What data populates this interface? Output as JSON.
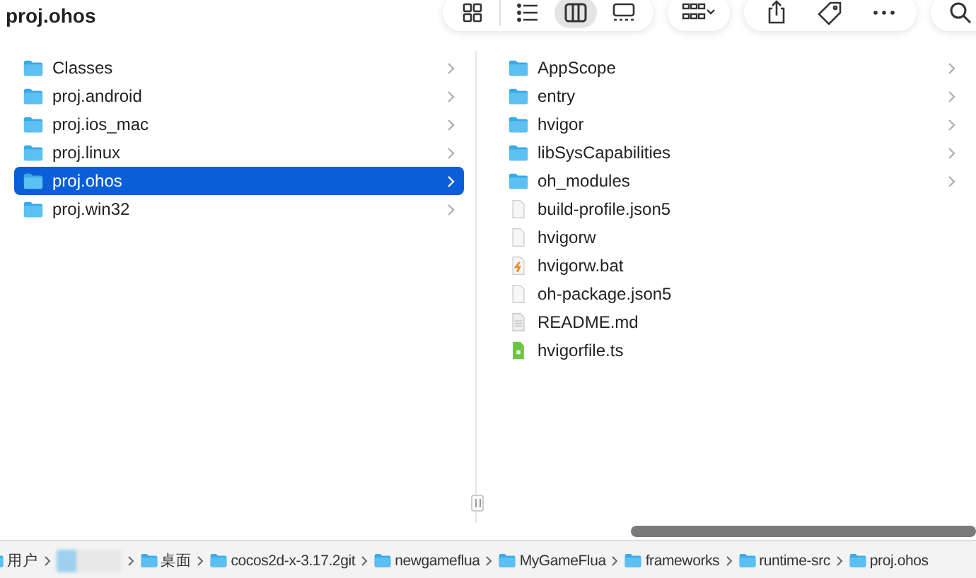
{
  "window": {
    "title": "proj.ohos"
  },
  "toolbar": {
    "view_modes": [
      {
        "kind": "icons",
        "selected": false
      },
      {
        "kind": "list",
        "selected": false
      },
      {
        "kind": "columns",
        "selected": true
      },
      {
        "kind": "gallery",
        "selected": false
      }
    ]
  },
  "columns": [
    {
      "items": [
        {
          "name": "Classes",
          "kind": "folder",
          "selected": false
        },
        {
          "name": "proj.android",
          "kind": "folder",
          "selected": false
        },
        {
          "name": "proj.ios_mac",
          "kind": "folder",
          "selected": false
        },
        {
          "name": "proj.linux",
          "kind": "folder",
          "selected": false
        },
        {
          "name": "proj.ohos",
          "kind": "folder",
          "selected": true
        },
        {
          "name": "proj.win32",
          "kind": "folder",
          "selected": false
        }
      ]
    },
    {
      "items": [
        {
          "name": "AppScope",
          "kind": "folder",
          "selected": false
        },
        {
          "name": "entry",
          "kind": "folder",
          "selected": false
        },
        {
          "name": "hvigor",
          "kind": "folder",
          "selected": false
        },
        {
          "name": "libSysCapabilities",
          "kind": "folder",
          "selected": false
        },
        {
          "name": "oh_modules",
          "kind": "folder",
          "selected": false
        },
        {
          "name": "build-profile.json5",
          "kind": "file",
          "selected": false
        },
        {
          "name": "hvigorw",
          "kind": "file",
          "selected": false
        },
        {
          "name": "hvigorw.bat",
          "kind": "script",
          "selected": false
        },
        {
          "name": "oh-package.json5",
          "kind": "file",
          "selected": false
        },
        {
          "name": "README.md",
          "kind": "text",
          "selected": false
        },
        {
          "name": "hvigorfile.ts",
          "kind": "code",
          "selected": false
        }
      ]
    }
  ],
  "path_bar": [
    {
      "label": "用户",
      "kind": "folder"
    },
    {
      "kind": "redacted"
    },
    {
      "label": "桌面",
      "kind": "folder"
    },
    {
      "label": "cocos2d-x-3.17.2git",
      "kind": "folder"
    },
    {
      "label": "newgameflua",
      "kind": "folder"
    },
    {
      "label": "MyGameFlua",
      "kind": "folder"
    },
    {
      "label": "frameworks",
      "kind": "folder"
    },
    {
      "label": "runtime-src",
      "kind": "folder"
    },
    {
      "label": "proj.ohos",
      "kind": "folder"
    }
  ]
}
